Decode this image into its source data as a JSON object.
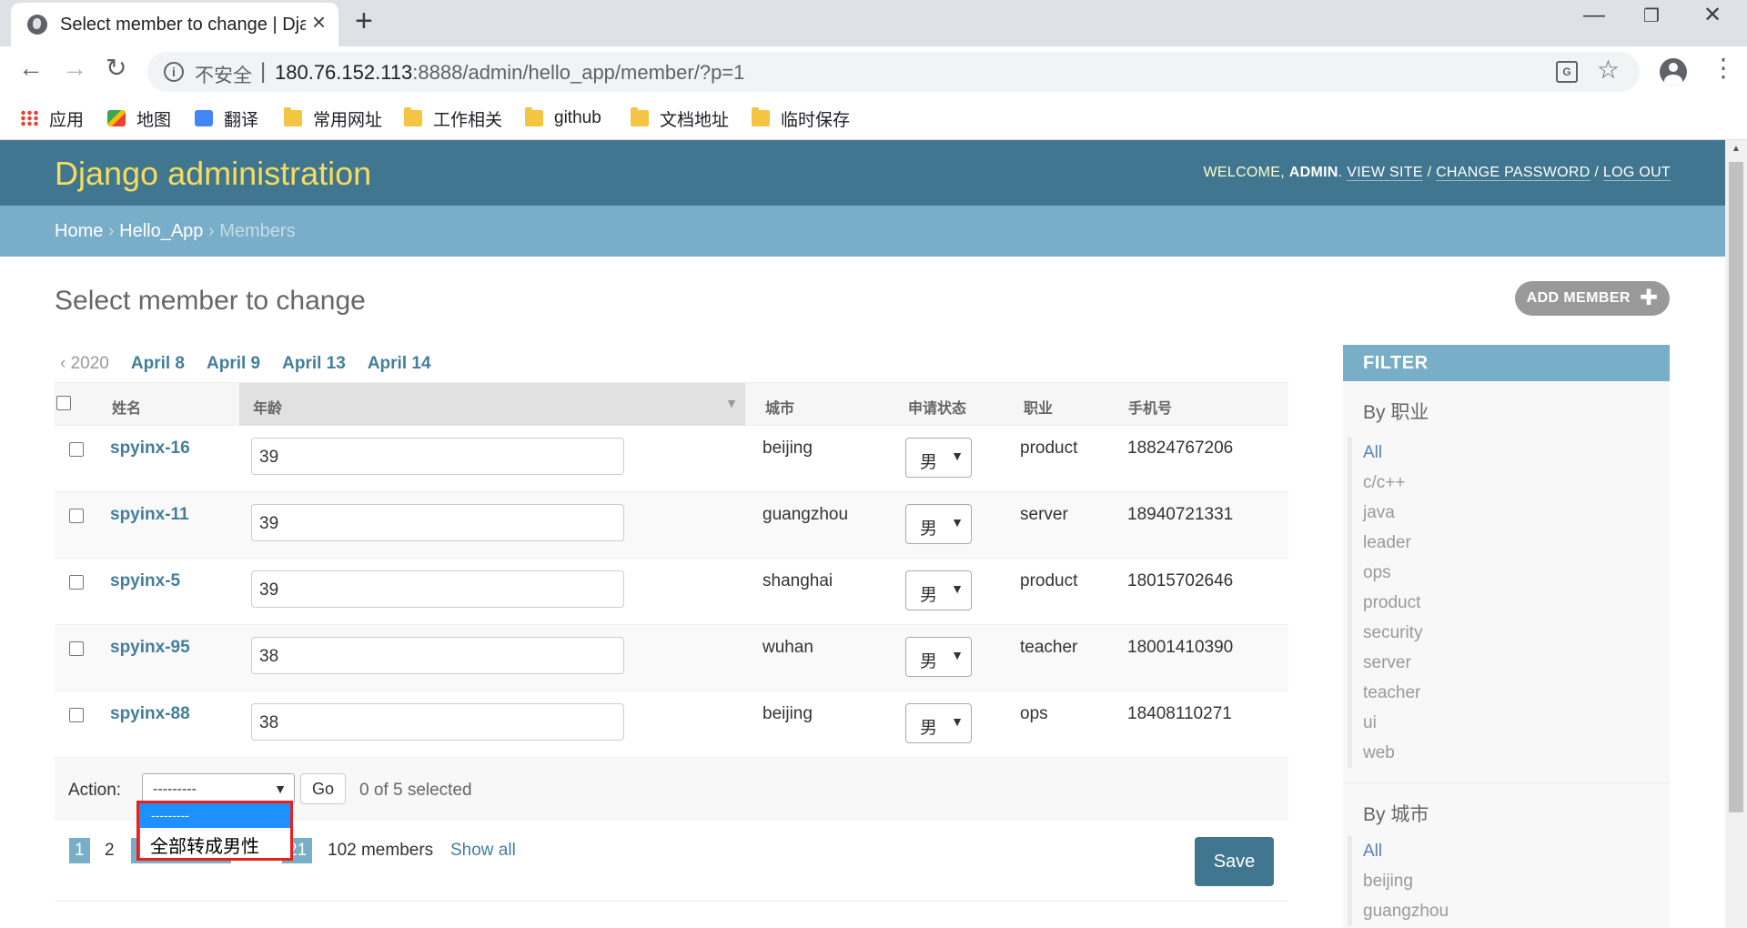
{
  "browser": {
    "tab_title": "Select member to change | Django",
    "insecure_label": "不安全",
    "url_host": "180.76.152.113",
    "url_rest": ":8888/admin/hello_app/member/?p=1",
    "bookmarks": [
      {
        "label": "应用",
        "icon": "apps-icon"
      },
      {
        "label": "地图",
        "icon": "maps-icon"
      },
      {
        "label": "翻译",
        "icon": "translate-icon"
      },
      {
        "label": "常用网址",
        "icon": "folder-icon"
      },
      {
        "label": "工作相关",
        "icon": "folder-icon"
      },
      {
        "label": "github",
        "icon": "folder-icon"
      },
      {
        "label": "文档地址",
        "icon": "folder-icon"
      },
      {
        "label": "临时保存",
        "icon": "folder-icon"
      }
    ]
  },
  "header": {
    "brand": "Django administration",
    "welcome": "WELCOME,",
    "user": "ADMIN",
    "view_site": "VIEW SITE",
    "change_password": "CHANGE PASSWORD",
    "logout": "LOG OUT"
  },
  "breadcrumbs": {
    "home": "Home",
    "app": "Hello_App",
    "current": "Members"
  },
  "page": {
    "title": "Select member to change",
    "add_button": "ADD MEMBER"
  },
  "date_hierarchy": {
    "back": "‹ 2020",
    "items": [
      "April 8",
      "April 9",
      "April 13",
      "April 14"
    ]
  },
  "table": {
    "columns": [
      "姓名",
      "年龄",
      "城市",
      "申请状态",
      "职业",
      "手机号"
    ],
    "rows": [
      {
        "name": "spyinx-16",
        "age": "39",
        "city": "beijing",
        "status": "男",
        "job": "product",
        "phone": "18824767206"
      },
      {
        "name": "spyinx-11",
        "age": "39",
        "city": "guangzhou",
        "status": "男",
        "job": "server",
        "phone": "18940721331"
      },
      {
        "name": "spyinx-5",
        "age": "39",
        "city": "shanghai",
        "status": "男",
        "job": "product",
        "phone": "18015702646"
      },
      {
        "name": "spyinx-95",
        "age": "38",
        "city": "wuhan",
        "status": "男",
        "job": "teacher",
        "phone": "18001410390"
      },
      {
        "name": "spyinx-88",
        "age": "38",
        "city": "beijing",
        "status": "男",
        "job": "ops",
        "phone": "18408110271"
      }
    ]
  },
  "actions": {
    "label": "Action:",
    "selected_option": "---------",
    "options": [
      "---------",
      "全部转成男性"
    ],
    "go": "Go",
    "counter": "0 of 5 selected"
  },
  "pagination": {
    "current": "1",
    "next": "2",
    "last_fragment": "21",
    "total": "102 members",
    "show_all": "Show all"
  },
  "save": "Save",
  "filter": {
    "title": "FILTER",
    "groups": [
      {
        "title": "By 职业",
        "items": [
          "All",
          "c/c++",
          "java",
          "leader",
          "ops",
          "product",
          "security",
          "server",
          "teacher",
          "ui",
          "web"
        ]
      },
      {
        "title": "By 城市",
        "items": [
          "All",
          "beijing",
          "guangzhou"
        ]
      }
    ]
  },
  "colors": {
    "header": "#417690",
    "breadcrumbs": "#79aec8",
    "brand": "#f5dd5d",
    "link": "#447e9b",
    "highlight": "#e8211c",
    "option_selected": "#1e90ff"
  }
}
